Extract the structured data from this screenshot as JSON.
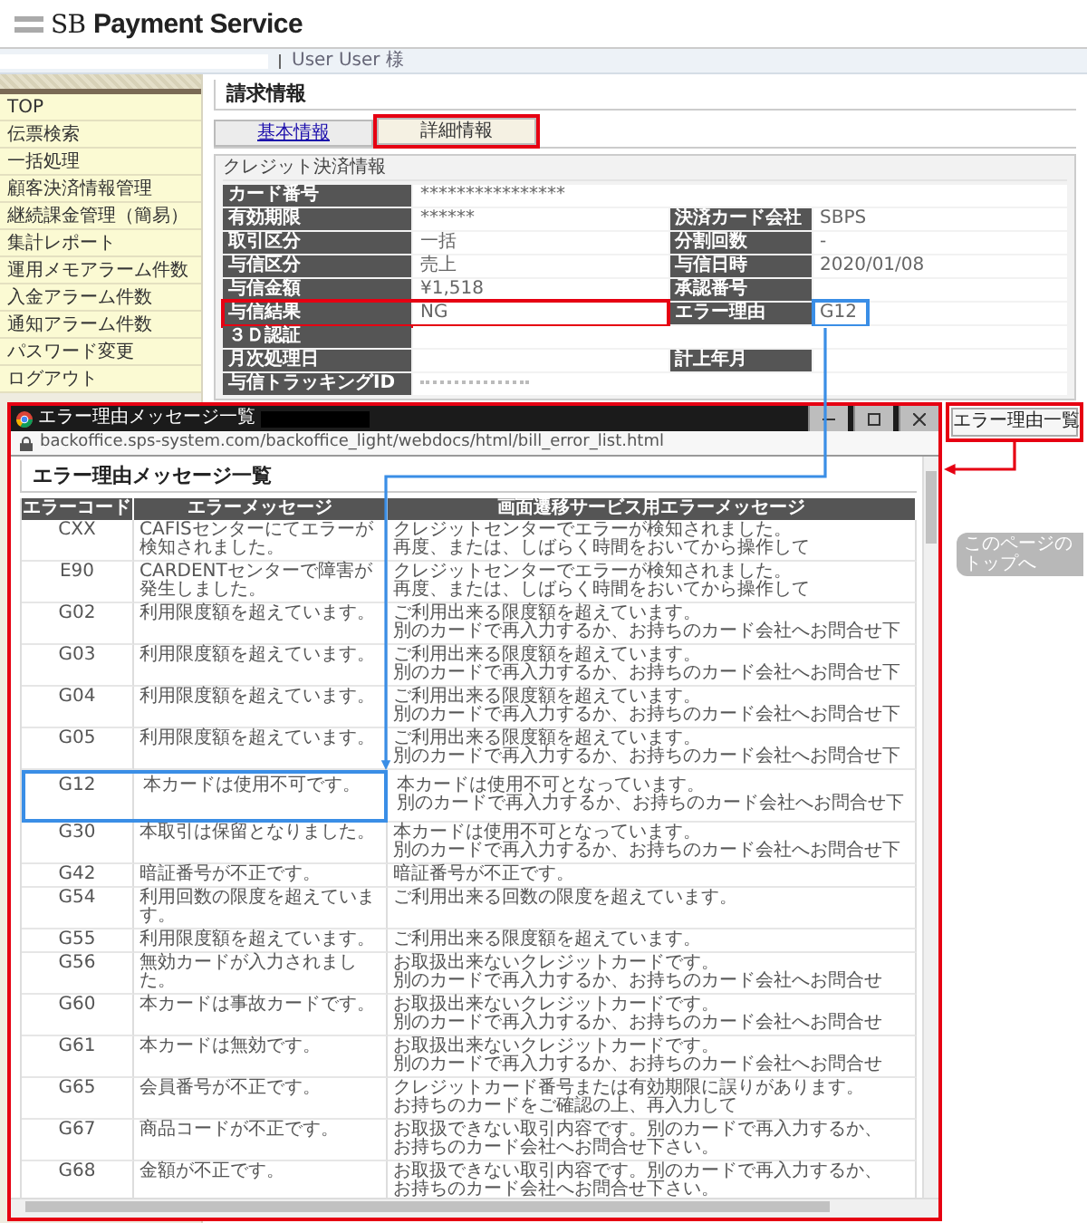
{
  "header": {
    "logo_initials": "SB",
    "logo_name": "Payment Service"
  },
  "user_bar": {
    "user_name": "User User 様"
  },
  "sidebar": {
    "items": [
      "TOP",
      "伝票検索",
      "一括処理",
      "顧客決済情報管理",
      "継続課金管理（簡易）",
      "集計レポート",
      "運用メモアラーム件数",
      "入金アラーム件数",
      "通知アラーム件数",
      "パスワード変更",
      "ログアウト"
    ]
  },
  "page_title": "請求情報",
  "tabs": [
    {
      "label": "基本情報",
      "selected": false,
      "marked": false
    },
    {
      "label": "詳細情報",
      "selected": true,
      "marked": true,
      "color": "#e60012"
    }
  ],
  "section_title": "クレジット決済情報",
  "detail_rows": [
    {
      "pairs": [
        {
          "label": "カード番号",
          "value": "****************",
          "marked": false
        }
      ]
    },
    {
      "pairs": [
        {
          "label": "有効期限",
          "value": "******",
          "marked": false
        },
        {
          "label": "決済カード会社",
          "value": "SBPS",
          "marked": false
        }
      ]
    },
    {
      "pairs": [
        {
          "label": "取引区分",
          "value": "一括",
          "marked": false
        },
        {
          "label": "分割回数",
          "value": "-",
          "marked": false
        }
      ]
    },
    {
      "pairs": [
        {
          "label": "与信区分",
          "value": "売上",
          "marked": false
        },
        {
          "label": "与信日時",
          "value": "2020/01/08",
          "marked": false
        }
      ]
    },
    {
      "pairs": [
        {
          "label": "与信金額",
          "value": "¥1,518",
          "marked": false
        },
        {
          "label": "承認番号",
          "marked": false
        }
      ]
    },
    {
      "pairs": [
        {
          "label": "与信結果",
          "value": "NG",
          "marked": true,
          "color": "#e60012"
        },
        {
          "label": "エラー理由",
          "value": "G12",
          "marked": true,
          "color": "#3a8ee6"
        }
      ]
    },
    {
      "pairs": [
        {
          "label": "３Ｄ認証",
          "marked": false
        }
      ]
    },
    {
      "pairs": [
        {
          "label": "月次処理日",
          "marked": false
        },
        {
          "label": "計上年月",
          "marked": false
        }
      ]
    },
    {
      "pairs": [
        {
          "label": "与信トラッキングID",
          "masked": true,
          "marked": false
        }
      ]
    }
  ],
  "error_list_button": "エラー理由一覧",
  "page_top_link": "このページのトップへ",
  "popup": {
    "title": "エラー理由メッセージ一覧",
    "url": "backoffice.sps-system.com/backoffice_light/webdocs/html/bill_error_list.html",
    "heading": "エラー理由メッセージ一覧",
    "columns": [
      "エラーコード",
      "エラーメッセージ",
      "画面遷移サービス用エラーメッセージ"
    ],
    "rows": [
      {
        "code": "CXX",
        "message": "CAFISセンターにてエラーが検知されました。",
        "service_message": [
          "クレジットセンターでエラーが検知されました。",
          "再度、または、しばらく時間をおいてから操作して"
        ],
        "marked": false
      },
      {
        "code": "E90",
        "message": "CARDENTセンターで障害が発生しました。",
        "service_message": [
          "クレジットセンターでエラーが検知されました。",
          "再度、または、しばらく時間をおいてから操作して"
        ],
        "marked": false
      },
      {
        "code": "G02",
        "message": "利用限度額を超えています。",
        "service_message": [
          "ご利用出来る限度額を超えています。",
          "別のカードで再入力するか、お持ちのカード会社へお問合せ下"
        ],
        "marked": false
      },
      {
        "code": "G03",
        "message": "利用限度額を超えています。",
        "service_message": [
          "ご利用出来る限度額を超えています。",
          "別のカードで再入力するか、お持ちのカード会社へお問合せ下"
        ],
        "marked": false
      },
      {
        "code": "G04",
        "message": "利用限度額を超えています。",
        "service_message": [
          "ご利用出来る限度額を超えています。",
          "別のカードで再入力するか、お持ちのカード会社へお問合せ下"
        ],
        "marked": false
      },
      {
        "code": "G05",
        "message": "利用限度額を超えています。",
        "service_message": [
          "ご利用出来る限度額を超えています。",
          "別のカードで再入力するか、お持ちのカード会社へお問合せ下"
        ],
        "marked": false
      },
      {
        "code": "G12",
        "message": "本カードは使用不可です。",
        "service_message": [
          "本カードは使用不可となっています。",
          "別のカードで再入力するか、お持ちのカード会社へお問合せ下"
        ],
        "marked": true,
        "color": "#3a8ee6"
      },
      {
        "code": "G30",
        "message": "本取引は保留となりました。",
        "service_message": [
          "本カードは使用不可となっています。",
          "別のカードで再入力するか、お持ちのカード会社へお問合せ下"
        ],
        "marked": false
      },
      {
        "code": "G42",
        "message": "暗証番号が不正です。",
        "service_message": [
          "暗証番号が不正です。"
        ],
        "marked": false
      },
      {
        "code": "G54",
        "message": "利用回数の限度を超えています。",
        "service_message": [
          "ご利用出来る回数の限度を超えています。"
        ],
        "marked": false
      },
      {
        "code": "G55",
        "message": "利用限度額を超えています。",
        "service_message": [
          "ご利用出来る限度額を超えています。"
        ],
        "marked": false
      },
      {
        "code": "G56",
        "message": "無効カードが入力されました。",
        "service_message": [
          "お取扱出来ないクレジットカードです。",
          "別のカードで再入力するか、お持ちのカード会社へお問合せ"
        ],
        "marked": false
      },
      {
        "code": "G60",
        "message": "本カードは事故カードです。",
        "service_message": [
          "お取扱出来ないクレジットカードです。",
          "別のカードで再入力するか、お持ちのカード会社へお問合せ"
        ],
        "marked": false
      },
      {
        "code": "G61",
        "message": "本カードは無効です。",
        "service_message": [
          "お取扱出来ないクレジットカードです。",
          "別のカードで再入力するか、お持ちのカード会社へお問合せ"
        ],
        "marked": false
      },
      {
        "code": "G65",
        "message": "会員番号が不正です。",
        "service_message": [
          "クレジットカード番号または有効期限に誤りがあります。",
          "お持ちのカードをご確認の上、再入力して"
        ],
        "marked": false
      },
      {
        "code": "G67",
        "message": "商品コードが不正です。",
        "service_message": [
          "お取扱できない取引内容です。別のカードで再入力するか、お持ちのカード会社へお問合せ下さい。"
        ],
        "marked": false
      },
      {
        "code": "G68",
        "message": "金額が不正です。",
        "service_message": [
          "お取扱できない取引内容です。別のカードで再入力するか、お持ちのカード会社へお問合せ下さい。"
        ],
        "marked": false
      }
    ]
  }
}
